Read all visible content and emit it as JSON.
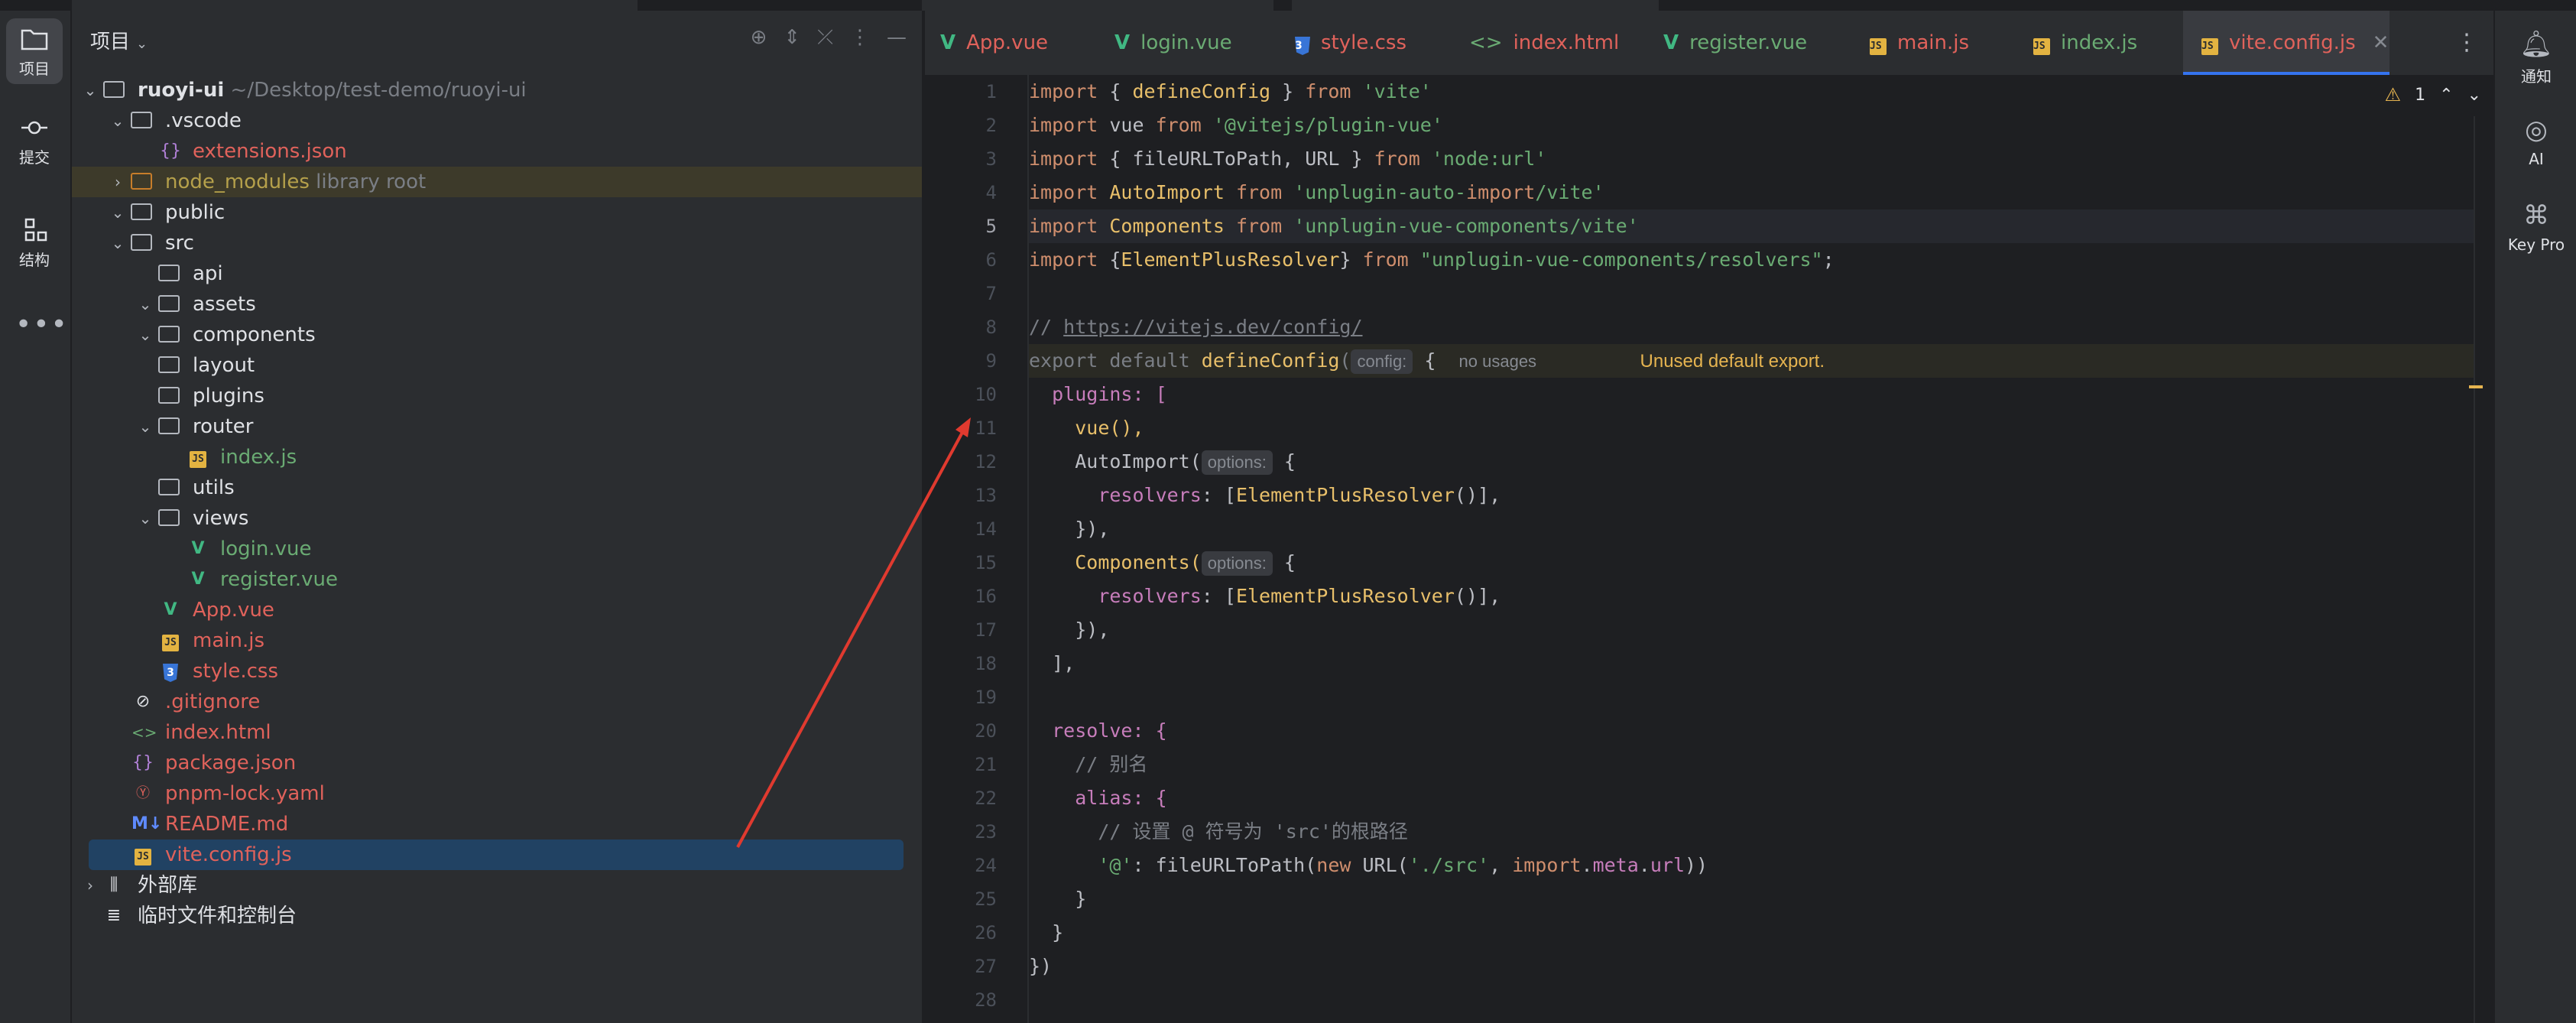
{
  "sidebar_left": {
    "items": [
      {
        "label": "项目",
        "icon": "folder-icon"
      },
      {
        "label": "提交",
        "icon": "commit-icon"
      },
      {
        "label": "结构",
        "icon": "structure-icon"
      }
    ],
    "more": "•••"
  },
  "project_panel": {
    "title": "项目",
    "tree": [
      {
        "name": "ruoyi-ui",
        "extra": "~/Desktop/test-demo/ruoyi-ui"
      },
      {
        "name": ".vscode"
      },
      {
        "name": "extensions.json"
      },
      {
        "name": "node_modules",
        "extra": "library root"
      },
      {
        "name": "public"
      },
      {
        "name": "src"
      },
      {
        "name": "api"
      },
      {
        "name": "assets"
      },
      {
        "name": "components"
      },
      {
        "name": "layout"
      },
      {
        "name": "plugins"
      },
      {
        "name": "router"
      },
      {
        "name": "index.js"
      },
      {
        "name": "utils"
      },
      {
        "name": "views"
      },
      {
        "name": "login.vue"
      },
      {
        "name": "register.vue"
      },
      {
        "name": "App.vue"
      },
      {
        "name": "main.js"
      },
      {
        "name": "style.css"
      },
      {
        "name": ".gitignore"
      },
      {
        "name": "index.html"
      },
      {
        "name": "package.json"
      },
      {
        "name": "pnpm-lock.yaml"
      },
      {
        "name": "README.md"
      },
      {
        "name": "vite.config.js"
      },
      {
        "name": "外部库"
      },
      {
        "name": "临时文件和控制台"
      }
    ]
  },
  "tabs": [
    {
      "label": "App.vue"
    },
    {
      "label": "login.vue"
    },
    {
      "label": "style.css"
    },
    {
      "label": "index.html"
    },
    {
      "label": "register.vue"
    },
    {
      "label": "main.js"
    },
    {
      "label": "index.js"
    },
    {
      "label": "vite.config.js"
    }
  ],
  "editor": {
    "warning_count": "1",
    "line_numbers": [
      "1",
      "2",
      "3",
      "4",
      "5",
      "6",
      "7",
      "8",
      "9",
      "10",
      "11",
      "12",
      "13",
      "14",
      "15",
      "16",
      "17",
      "18",
      "19",
      "20",
      "21",
      "22",
      "23",
      "24",
      "25",
      "26",
      "27",
      "28"
    ],
    "current_line": "5",
    "lines": {
      "l1": "import { defineConfig } from 'vite'",
      "l2": "import vue from '@vitejs/plugin-vue'",
      "l3": "import { fileURLToPath, URL } from 'node:url'",
      "l4": "import AutoImport from 'unplugin-auto-import/vite'",
      "l5": "import Components from 'unplugin-vue-components/vite'",
      "l6": "import {ElementPlusResolver} from \"unplugin-vue-components/resolvers\";",
      "l8_prefix": "// ",
      "l8_url": "https://vitejs.dev/config/",
      "l9": "export default defineConfig(",
      "l9_hint": "config:",
      "l9_tail": "{",
      "l9_usage": "no usages",
      "l9_warning": "Unused default export.",
      "l10": "plugins: [",
      "l11": "vue(),",
      "l12": "AutoImport(",
      "l12_hint": "options:",
      "l12_tail": "{",
      "l13": "resolvers: [ElementPlusResolver()],",
      "l14": "}),",
      "l15": "Components(",
      "l15_hint": "options:",
      "l15_tail": "{",
      "l16": "resolvers: [ElementPlusResolver()],",
      "l17": "}),",
      "l18": "],",
      "l20": "resolve: {",
      "l21": "// 别名",
      "l22": "alias: {",
      "l23": "// 设置 @ 符号为 'src'的根路径",
      "l24": "'@': fileURLToPath(new URL('./src', import.meta.url))",
      "l25": "}",
      "l26": "}",
      "l27": "})"
    }
  },
  "sidebar_right": {
    "items": [
      {
        "label": "通知",
        "icon": "bell-icon"
      },
      {
        "label": "AI",
        "icon": "ai-icon"
      },
      {
        "label": "Key Pro",
        "icon": "key-promoter-icon"
      }
    ]
  },
  "colors": {
    "accent": "#3574f0",
    "annotation_arrow": "#e03a2f",
    "warning": "#e6b450"
  }
}
